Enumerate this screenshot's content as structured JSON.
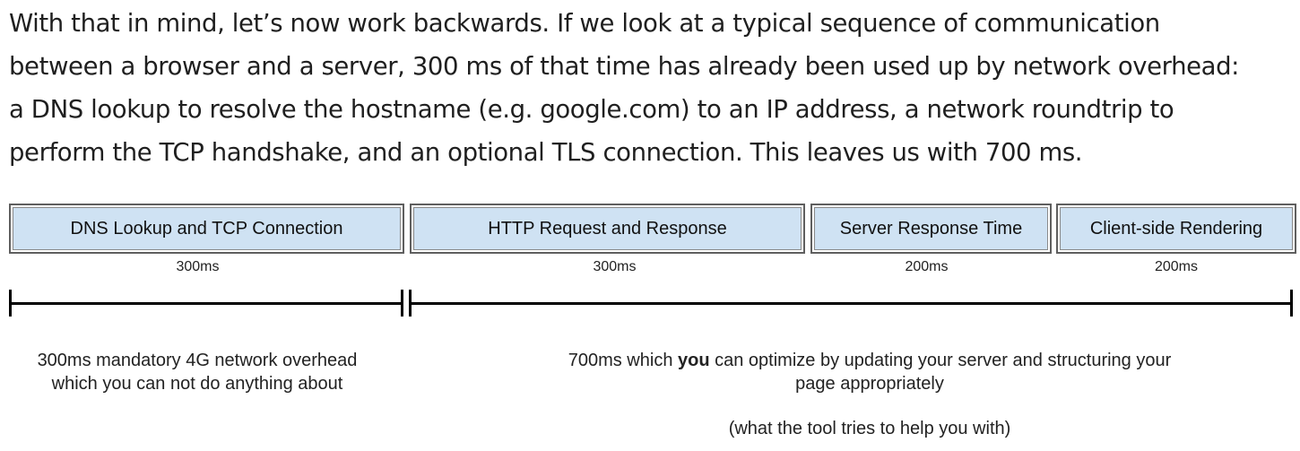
{
  "paragraph": {
    "lines": [
      "With that in mind, let’s now work backwards. If we look at a typical sequence of communication",
      "between a browser and a server, 300 ms of that time has already been used up by network overhead:",
      "a DNS lookup to resolve the hostname (e.g. google.com) to an IP address, a network roundtrip to",
      "perform the TCP handshake, and an optional TLS connection. This leaves us with 700 ms."
    ]
  },
  "diagram": {
    "box_fill": "#cfe2f3",
    "phases": [
      {
        "label": "DNS Lookup and TCP Connection",
        "duration": "300ms"
      },
      {
        "label": "HTTP Request and Response",
        "duration": "300ms"
      },
      {
        "label": "Server Response Time",
        "duration": "200ms"
      },
      {
        "label": "Client-side Rendering",
        "duration": "200ms"
      }
    ],
    "left_caption": {
      "line1": "300ms mandatory 4G network overhead",
      "line2": "which you can not do anything about"
    },
    "right_caption": {
      "prefix": "700ms which ",
      "emphasis": "you",
      "suffix": " can optimize by updating your server and structuring your",
      "line2": "page appropriately",
      "note": "(what the tool tries to help you with)"
    }
  }
}
